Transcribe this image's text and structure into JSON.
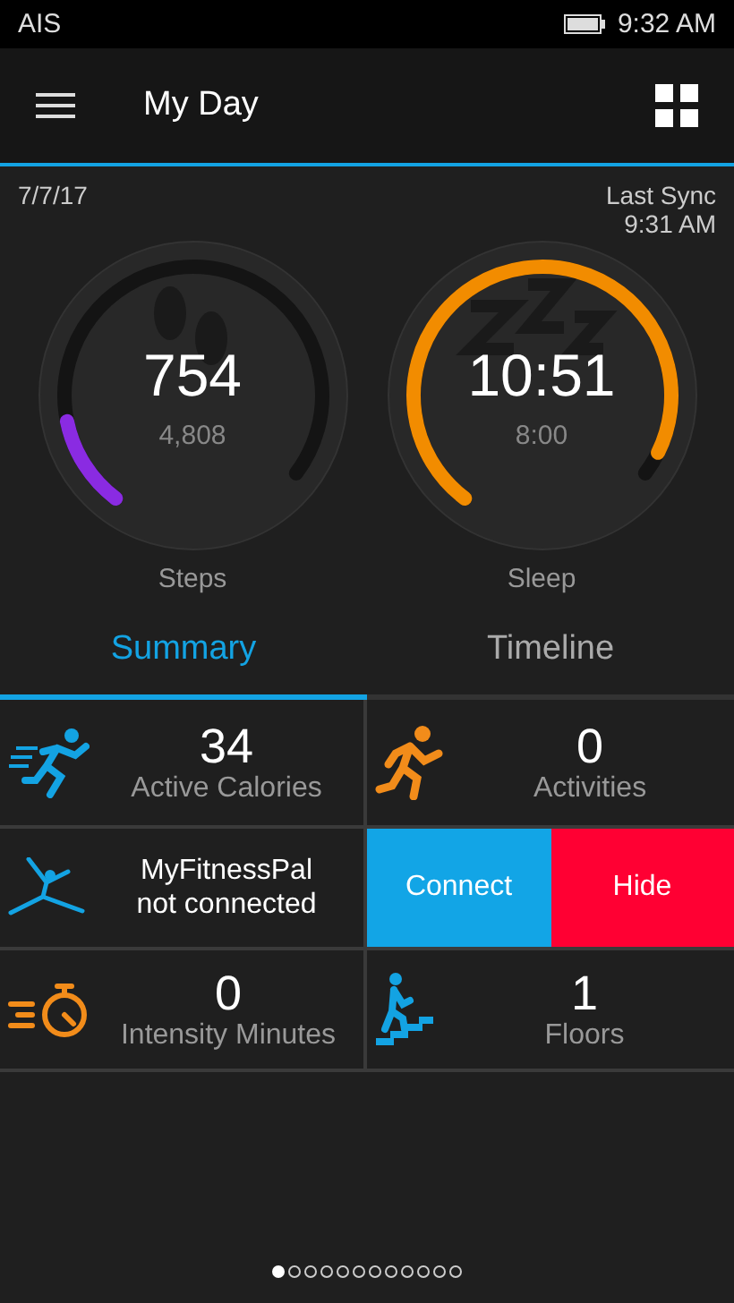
{
  "status_bar": {
    "carrier": "AIS",
    "time": "9:32 AM"
  },
  "app_bar": {
    "title": "My Day"
  },
  "header": {
    "date": "7/7/17",
    "sync_label": "Last Sync",
    "sync_time": "9:31 AM"
  },
  "gauges": [
    {
      "kind": "steps",
      "value": "754",
      "goal": "4,808",
      "label": "Steps",
      "level": 0.16,
      "color": "#8a2be2"
    },
    {
      "kind": "sleep",
      "value": "10:51",
      "goal": "8:00",
      "label": "Sleep",
      "level": 1,
      "color": "#f28c00"
    }
  ],
  "tabs": [
    {
      "label": "Summary",
      "selected": true
    },
    {
      "label": "Timeline",
      "selected": false
    }
  ],
  "tiles": [
    {
      "kind": "stat",
      "value": "34",
      "label": "Active Calories"
    },
    {
      "kind": "stat",
      "value": "0",
      "label": "Activities"
    },
    {
      "kind": "notice",
      "lines": [
        "MyFitnessPal",
        "not connected"
      ]
    },
    {
      "kind": "actions",
      "buttons": [
        {
          "label": "Connect",
          "color": "#12a5e6"
        },
        {
          "label": "Hide",
          "color": "#ff0033"
        }
      ]
    },
    {
      "kind": "stat",
      "value": "0",
      "label": "Intensity Minutes"
    },
    {
      "kind": "stat",
      "value": "1",
      "label": "Floors"
    }
  ],
  "pages": [
    {
      "selected": true
    },
    {
      "selected": false
    },
    {
      "selected": false
    },
    {
      "selected": false
    },
    {
      "selected": false
    },
    {
      "selected": false
    },
    {
      "selected": false
    },
    {
      "selected": false
    },
    {
      "selected": false
    },
    {
      "selected": false
    },
    {
      "selected": false
    },
    {
      "selected": false
    }
  ]
}
